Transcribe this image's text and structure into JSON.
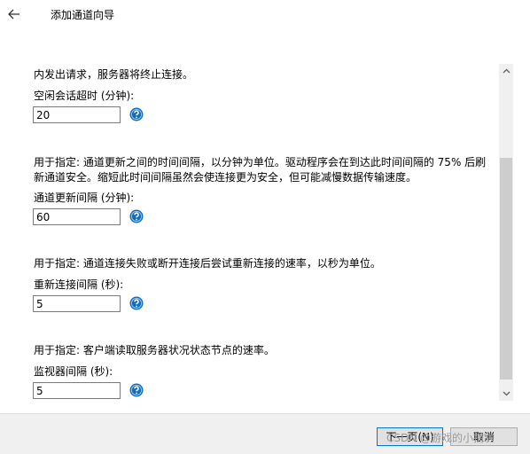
{
  "window": {
    "title": "添加通道向导"
  },
  "sections": [
    {
      "description_lines": [
        "内发出请求，服务器将终止连接。"
      ],
      "label": "空闲会话超时 (分钟):",
      "value": "20"
    },
    {
      "description_lines": [
        "用于指定: 通道更新之间的时间间隔，以分钟为单位。驱动程序会在到达此时间间隔的 75% 后刷",
        "新通道安全。缩短此时间间隔虽然会使连接更为安全，但可能减慢数据传输速度。"
      ],
      "label": "通道更新间隔 (分钟):",
      "value": "60"
    },
    {
      "description_lines": [
        "用于指定: 通道连接失败或断开连接后尝试重新连接的速率，以秒为单位。"
      ],
      "label": "重新连接间隔 (秒):",
      "value": "5"
    },
    {
      "description_lines": [
        "用于指定: 客户端读取服务器状况状态节点的速率。"
      ],
      "label": "监视器间隔 (秒):",
      "value": "5"
    }
  ],
  "buttons": {
    "next": "下一页(N)",
    "cancel": "取消"
  },
  "watermark": "CSDN @游戏的小捕豹",
  "colors": {
    "help_icon": "#0f6cbd",
    "accent": "#0078d7"
  }
}
